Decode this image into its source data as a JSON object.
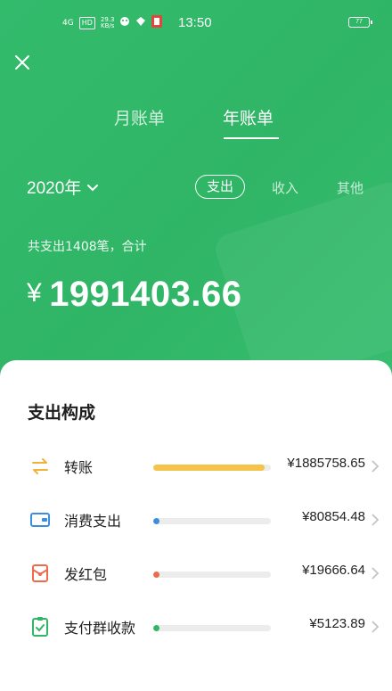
{
  "status_bar": {
    "network": "4G",
    "hd": "HD",
    "speed_value": "29.3",
    "speed_unit": "KB/s",
    "time": "13:50",
    "battery": "77"
  },
  "tabs": [
    {
      "label": "月账单",
      "active": false
    },
    {
      "label": "年账单",
      "active": true
    }
  ],
  "year_selector": {
    "label": "2020年"
  },
  "filters": [
    {
      "label": "支出",
      "active": true
    },
    {
      "label": "收入",
      "active": false
    },
    {
      "label": "其他",
      "active": false
    }
  ],
  "summary": {
    "text": "共支出1408笔，合计",
    "currency": "¥",
    "total": "1991403.66"
  },
  "breakdown": {
    "title": "支出构成",
    "items": [
      {
        "label": "转账",
        "icon": "transfer-icon",
        "amount": "¥1885758.65",
        "share": 0.947,
        "color": "#f5c24a"
      },
      {
        "label": "消费支出",
        "icon": "wallet-icon",
        "amount": "¥80854.48",
        "share": 0.041,
        "color": "#3b8de0"
      },
      {
        "label": "发红包",
        "icon": "red-packet-icon",
        "amount": "¥19666.64",
        "share": 0.01,
        "color": "#ee6a4c"
      },
      {
        "label": "支付群收款",
        "icon": "group-collect-icon",
        "amount": "¥5123.89",
        "share": 0.003,
        "color": "#2fb766"
      }
    ]
  },
  "colors": {
    "brand_green": "#2fb766",
    "card_bg": "#ffffff"
  }
}
